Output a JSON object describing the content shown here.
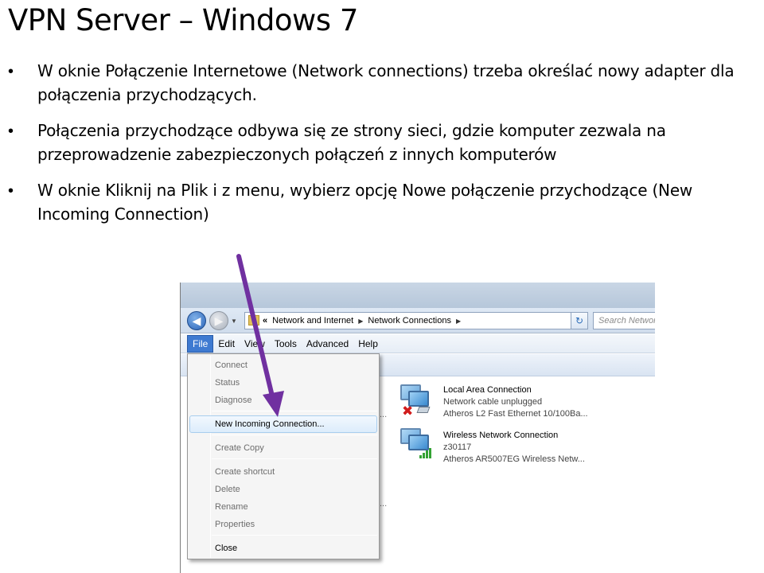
{
  "slide": {
    "title": "VPN Server – Windows 7",
    "bullets": [
      "W oknie Połączenie Internetowe (Network connections) trzeba określać nowy adapter dla połączenia przychodzących.",
      "Połączenia przychodzące odbywa się ze strony sieci, gdzie komputer zezwala na przeprowadzenie zabezpieczonych połączeń z innych komputerów",
      "W oknie Kliknij na Plik i z menu, wybierz opcję Nowe połączenie przychodzące (New Incoming Connection)"
    ],
    "bullet_symbol": "•"
  },
  "window": {
    "address": {
      "chevron": "«",
      "crumbs": [
        "Network and Internet",
        "Network Connections"
      ]
    },
    "search_placeholder": "Search Network Connections",
    "menubar": [
      "File",
      "Edit",
      "View",
      "Tools",
      "Advanced",
      "Help"
    ],
    "active_menu": "File",
    "file_menu": {
      "items": [
        {
          "label": "Connect",
          "enabled": false
        },
        {
          "label": "Status",
          "enabled": false
        },
        {
          "label": "Diagnose",
          "enabled": false
        },
        {
          "label": "New Incoming Connection...",
          "enabled": true,
          "highlighted": true
        },
        {
          "label": "Create Copy",
          "enabled": false
        },
        {
          "label": "Create shortcut",
          "enabled": false
        },
        {
          "label": "Delete",
          "enabled": false
        },
        {
          "label": "Rename",
          "enabled": false
        },
        {
          "label": "Properties",
          "enabled": false
        },
        {
          "label": "Close",
          "enabled": true
        }
      ]
    },
    "connections": [
      {
        "name": "Local Area Connection",
        "status": "Network cable unplugged",
        "device": "Atheros L2 Fast Ethernet 10/100Ba...",
        "icon": "wired-network-disconnected-icon"
      },
      {
        "name": "Wireless Network Connection",
        "status": "z30117",
        "device": "Atheros AR5007EG Wireless Netw...",
        "icon": "wireless-network-icon"
      }
    ],
    "truncated_marker": "..."
  },
  "annotation": {
    "arrow_color": "#7030a0"
  }
}
